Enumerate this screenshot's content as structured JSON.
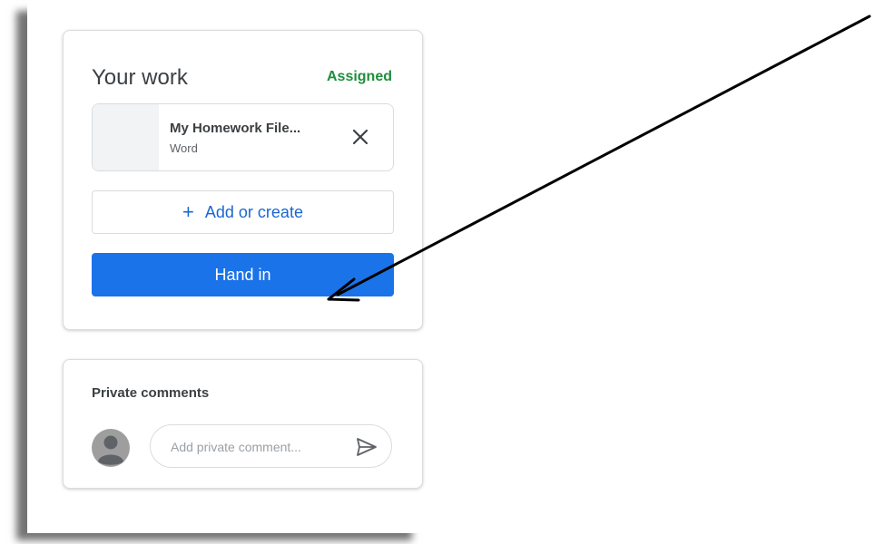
{
  "your_work": {
    "title": "Your work",
    "status": "Assigned",
    "attachment": {
      "name": "My Homework File...",
      "type": "Word"
    },
    "add_label": "Add or create",
    "hand_in_label": "Hand in"
  },
  "private_comments": {
    "title": "Private comments",
    "placeholder": "Add private comment..."
  },
  "icons": {
    "remove": "close-icon",
    "add": "plus-icon",
    "avatar": "person-icon",
    "send": "send-icon"
  },
  "colors": {
    "accent": "#1a73e8",
    "link": "#1967d2",
    "status_green": "#1e8e3e"
  }
}
